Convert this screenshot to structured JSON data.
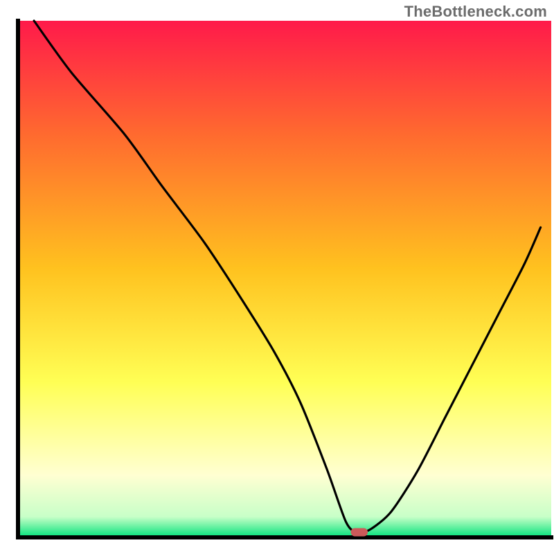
{
  "watermark": "TheBottleneck.com",
  "colors": {
    "gradient_top": "#ff1a4a",
    "gradient_mid_upper": "#ff7a2a",
    "gradient_mid": "#ffd21f",
    "gradient_mid_lower": "#ffff66",
    "gradient_cream": "#ffffd2",
    "gradient_green": "#00e27a",
    "curve_stroke": "#000000",
    "axis_stroke": "#000000",
    "marker_fill": "#cc5a5a",
    "watermark_color": "#6c6c6c"
  },
  "chart_data": {
    "type": "line",
    "title": "",
    "xlabel": "",
    "ylabel": "",
    "xlim": [
      0,
      100
    ],
    "ylim": [
      0,
      100
    ],
    "grid": false,
    "legend": false,
    "note": "Axis values are not labeled in the image; x and y are read off the plot frame as 0–100 (percent of plot area).",
    "series": [
      {
        "name": "bottleneck-curve",
        "x": [
          3.0,
          10.0,
          20.0,
          27.0,
          35.0,
          42.0,
          48.0,
          53.0,
          58.0,
          61.5,
          63.5,
          66.0,
          70.0,
          75.0,
          80.0,
          85.0,
          90.0,
          95.0,
          98.0
        ],
        "y": [
          100.0,
          90.0,
          78.0,
          68.0,
          57.0,
          46.0,
          36.0,
          26.0,
          13.0,
          3.0,
          1.0,
          1.5,
          5.0,
          13.0,
          23.0,
          33.0,
          43.0,
          53.0,
          60.0
        ]
      }
    ],
    "marker": {
      "name": "optimal-point",
      "x": 64.0,
      "y": 1.0,
      "shape": "rounded-bar",
      "width_pct": 3.2,
      "height_pct": 1.6
    },
    "background_gradient": {
      "direction": "vertical",
      "stops_pct": [
        {
          "pos": 0,
          "color": "#ff1a4a"
        },
        {
          "pos": 22,
          "color": "#ff6a2f"
        },
        {
          "pos": 48,
          "color": "#ffc21f"
        },
        {
          "pos": 70,
          "color": "#ffff55"
        },
        {
          "pos": 88,
          "color": "#ffffd2"
        },
        {
          "pos": 96,
          "color": "#c8ffc8"
        },
        {
          "pos": 100,
          "color": "#00e27a"
        }
      ]
    }
  }
}
